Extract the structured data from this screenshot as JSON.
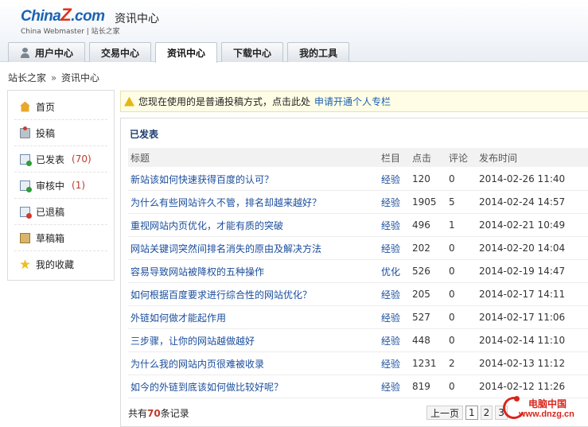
{
  "header": {
    "logo_china": "China",
    "logo_z": "Z",
    "logo_com": ".com",
    "logo_sub": "China Webmaster | 站长之家",
    "site_title": "资讯中心"
  },
  "nav": {
    "tabs": [
      {
        "label": "用户中心",
        "active": false,
        "icon": "user-icon"
      },
      {
        "label": "交易中心",
        "active": false
      },
      {
        "label": "资讯中心",
        "active": true
      },
      {
        "label": "下载中心",
        "active": false
      },
      {
        "label": "我的工具",
        "active": false
      }
    ]
  },
  "breadcrumb": {
    "home": "站长之家",
    "sep": "»",
    "current": "资讯中心"
  },
  "sidebar": {
    "items": [
      {
        "label": "首页",
        "count": "",
        "icon": "home-icon"
      },
      {
        "label": "投稿",
        "count": "",
        "icon": "submit-icon"
      },
      {
        "label": "已发表",
        "count": "(70)",
        "icon": "published-icon"
      },
      {
        "label": "审核中",
        "count": "(1)",
        "icon": "reviewing-icon"
      },
      {
        "label": "已退稿",
        "count": "",
        "icon": "returned-icon"
      },
      {
        "label": "草稿箱",
        "count": "",
        "icon": "draft-icon"
      },
      {
        "label": "我的收藏",
        "count": "",
        "icon": "star-icon"
      }
    ]
  },
  "notice": {
    "text": "您现在使用的是普通投稿方式，点击此处",
    "link": "申请开通个人专栏"
  },
  "panel": {
    "title": "已发表",
    "columns": [
      "标题",
      "栏目",
      "点击",
      "评论",
      "发布时间"
    ],
    "rows": [
      {
        "title": "新站该如何快速获得百度的认可？",
        "category": "经验",
        "clicks": "120",
        "comments": "0",
        "time": "2014-02-26 11:40"
      },
      {
        "title": "为什么有些网站许久不管，排名却越来越好？",
        "category": "经验",
        "clicks": "1905",
        "comments": "5",
        "time": "2014-02-24 14:57"
      },
      {
        "title": "重视网站内页优化，才能有质的突破",
        "category": "经验",
        "clicks": "496",
        "comments": "1",
        "time": "2014-02-21 10:49"
      },
      {
        "title": "网站关键词突然间排名消失的原由及解决方法",
        "category": "经验",
        "clicks": "202",
        "comments": "0",
        "time": "2014-02-20 14:04"
      },
      {
        "title": "容易导致网站被降权的五种操作",
        "category": "优化",
        "clicks": "526",
        "comments": "0",
        "time": "2014-02-19 14:47"
      },
      {
        "title": "如何根据百度要求进行综合性的网站优化？",
        "category": "经验",
        "clicks": "205",
        "comments": "0",
        "time": "2014-02-17 14:11"
      },
      {
        "title": "外链如何做才能起作用",
        "category": "经验",
        "clicks": "527",
        "comments": "0",
        "time": "2014-02-17 11:06"
      },
      {
        "title": "三步骤，让你的网站越做越好",
        "category": "经验",
        "clicks": "448",
        "comments": "0",
        "time": "2014-02-14 11:10"
      },
      {
        "title": "为什么我的网站内页很难被收录",
        "category": "经验",
        "clicks": "1231",
        "comments": "2",
        "time": "2014-02-13 11:12"
      },
      {
        "title": "如今的外链到底该如何做比较好呢？",
        "category": "经验",
        "clicks": "819",
        "comments": "0",
        "time": "2014-02-12 11:26"
      }
    ],
    "footer": {
      "total_prefix": "共有",
      "total_count": "70",
      "total_suffix": "条记录",
      "prev": "上一页",
      "pages": [
        "1",
        "2",
        "3"
      ],
      "current_page": "1"
    }
  },
  "watermark": {
    "text": "电脑中国",
    "url": "www.dnzg.cn"
  }
}
